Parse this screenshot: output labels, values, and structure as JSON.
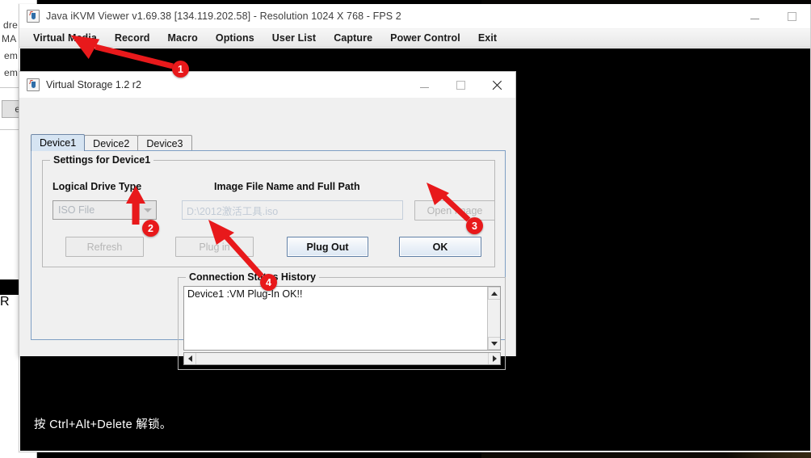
{
  "app": {
    "title": "Java iKVM Viewer v1.69.38 [134.119.202.58]  - Resolution 1024 X 768 - FPS 2",
    "icon": "java-coffee-icon",
    "window_controls": {
      "minimize": "—",
      "maximize": "□"
    },
    "menu": [
      {
        "label": "Virtual Media"
      },
      {
        "label": "Record"
      },
      {
        "label": "Macro"
      },
      {
        "label": "Options"
      },
      {
        "label": "User List"
      },
      {
        "label": "Capture"
      },
      {
        "label": "Power Control"
      },
      {
        "label": "Exit"
      }
    ],
    "remote_screen": {
      "lock_message": "按 Ctrl+Alt+Delete 解锁。",
      "wallpaper_description": "sea-cave-arch-beach-photo"
    }
  },
  "background_window": {
    "fragments": [
      "dre",
      "MA",
      "em",
      "em"
    ],
    "button_fragment": "e",
    "lower_fragment": "R"
  },
  "dialog": {
    "title": "Virtual Storage 1.2 r2",
    "icon": "java-coffee-icon",
    "window_controls": {
      "minimize": "—",
      "maximize": "□",
      "close": "✕"
    },
    "tabs": [
      {
        "label": "Device1",
        "active": true
      },
      {
        "label": "Device2",
        "active": false
      },
      {
        "label": "Device3",
        "active": false
      }
    ],
    "settings_group": {
      "title": "Settings for Device1",
      "drive_type_label": "Logical Drive Type",
      "drive_type_value": "ISO File",
      "drive_type_options": [
        "ISO File"
      ],
      "image_path_label": "Image File Name and Full Path",
      "image_path_value": "D:\\2012激活工具.iso",
      "open_image_label": "Open Image",
      "open_image_enabled": false,
      "buttons": [
        {
          "label": "Refresh",
          "enabled": false
        },
        {
          "label": "Plug in",
          "enabled": false
        },
        {
          "label": "Plug Out",
          "enabled": true
        },
        {
          "label": "OK",
          "enabled": true
        }
      ]
    },
    "history_group": {
      "title": "Connection Status History",
      "entries": [
        "Device1 :VM Plug-In OK!!"
      ],
      "scroll_icons": {
        "up": "scroll-up-arrow",
        "down": "scroll-down-arrow",
        "left": "scroll-left-arrow",
        "right": "scroll-right-arrow"
      }
    }
  },
  "annotations": {
    "color": "#e8191b",
    "markers": [
      {
        "number": "1",
        "target": "Virtual Media menu"
      },
      {
        "number": "2",
        "target": "Logical Drive Type dropdown"
      },
      {
        "number": "3",
        "target": "Open Image button"
      },
      {
        "number": "4",
        "target": "Plug in button"
      }
    ]
  }
}
